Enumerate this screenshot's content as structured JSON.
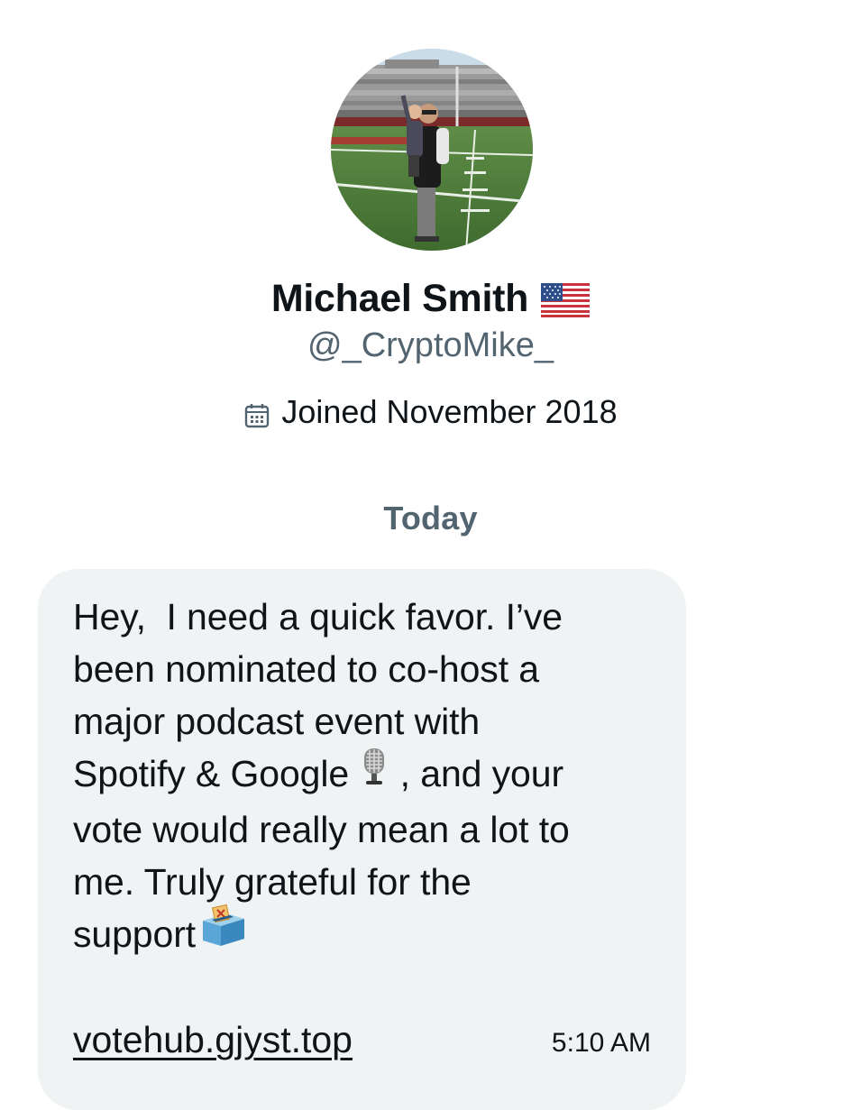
{
  "profile": {
    "display_name": "Michael Smith",
    "name_emoji": "flag-us-icon",
    "handle": "@_CryptoMike_",
    "joined_text": "Joined November 2018",
    "joined_icon": "calendar-icon"
  },
  "conversation": {
    "day_separator": "Today",
    "message": {
      "line_1": "Hey,  I need a quick favor. I’ve",
      "line_2": "been nominated to co-host a",
      "line_3": "major podcast event with",
      "line_4a": "Spotify & Google ",
      "line_4b": " , and your",
      "line_5": "vote would really mean a lot to",
      "line_6": "me. Truly grateful for the",
      "line_7": "support",
      "link": "vote​hub.gjyst.top",
      "time": "5:10 AM"
    }
  },
  "colors": {
    "bubble_bg": "#eff3f4",
    "secondary_text": "#536471",
    "primary_text": "#0f1419"
  }
}
